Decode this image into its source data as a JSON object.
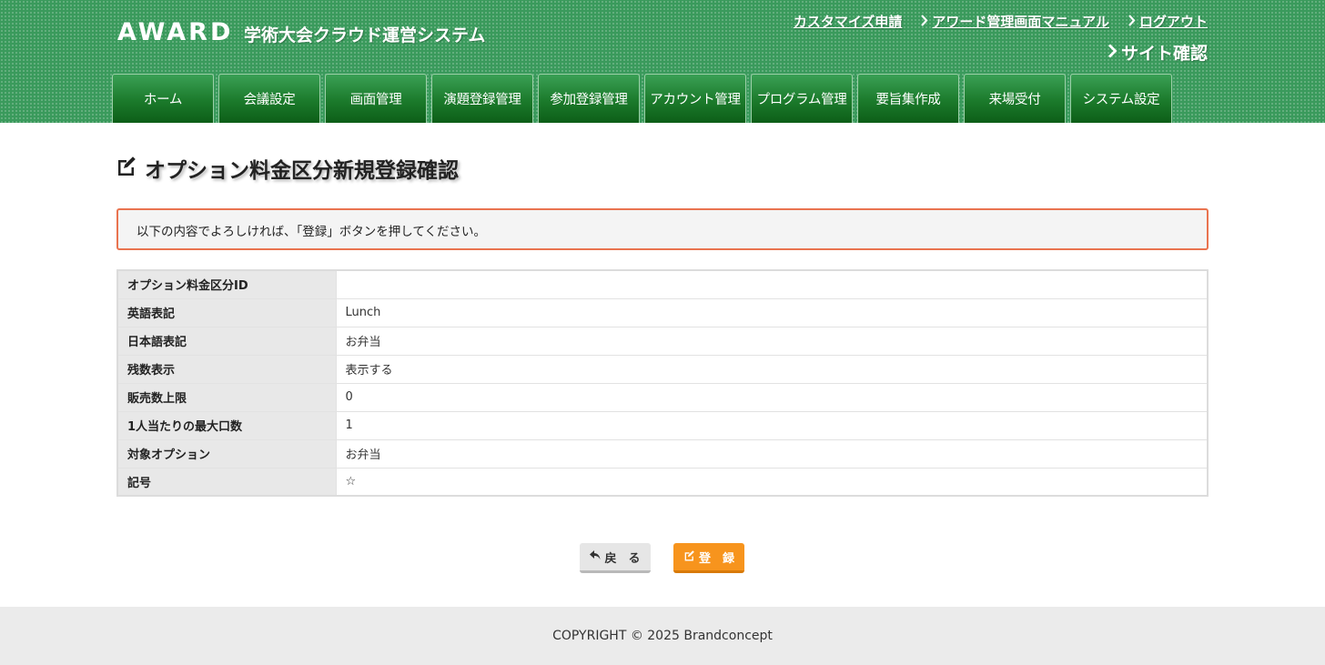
{
  "header": {
    "logo": "AWARD",
    "subtitle": "学術大会クラウド運営システム",
    "links": [
      {
        "label": "カスタマイズ申請",
        "chevron": false
      },
      {
        "label": "アワード管理画面マニュアル",
        "chevron": true
      },
      {
        "label": "ログアウト",
        "chevron": true
      }
    ],
    "site_check": "サイト確認"
  },
  "nav": {
    "items": [
      "ホーム",
      "会議設定",
      "画面管理",
      "演題登録管理",
      "参加登録管理",
      "アカウント管理",
      "プログラム管理",
      "要旨集作成",
      "来場受付",
      "システム設定"
    ]
  },
  "page": {
    "title": "オプション料金区分新規登録確認",
    "notice": "以下の内容でよろしければ、「登録」ボタンを押してください。"
  },
  "table": {
    "rows": [
      {
        "label": "オプション料金区分ID",
        "value": ""
      },
      {
        "label": "英語表記",
        "value": "Lunch"
      },
      {
        "label": "日本語表記",
        "value": "お弁当"
      },
      {
        "label": "残数表示",
        "value": "表示する"
      },
      {
        "label": "販売数上限",
        "value": "0"
      },
      {
        "label": "1人当たりの最大口数",
        "value": "1"
      },
      {
        "label": "対象オプション",
        "value": "お弁当"
      },
      {
        "label": "記号",
        "value": "☆"
      }
    ]
  },
  "buttons": {
    "back": "戻　る",
    "submit": "登　録"
  },
  "footer": {
    "copyright": "COPYRIGHT © 2025 Brandconcept"
  },
  "colors": {
    "header_green": "#3a9a5c",
    "nav_green": "#1b7a2b",
    "notice_border": "#e9734f",
    "submit_orange": "#f7941d"
  },
  "icons": {
    "title": "edit-icon",
    "back": "reply-arrow-icon",
    "submit": "edit-icon",
    "link": "chevron-right-icon"
  }
}
